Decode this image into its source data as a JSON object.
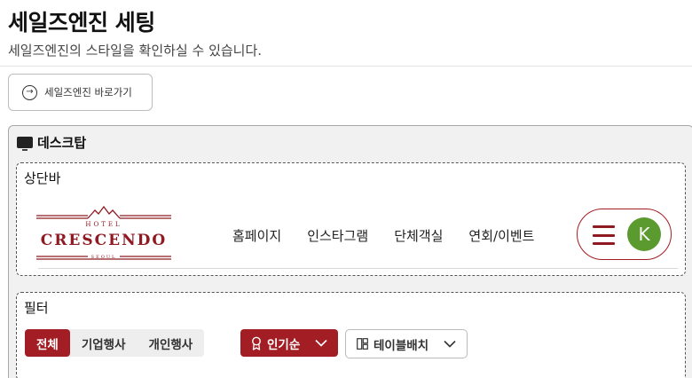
{
  "header": {
    "title": "세일즈엔진 세팅",
    "subtitle": "세일즈엔진의 스타일을 확인하실 수 있습니다."
  },
  "goto_button": {
    "label": "세일즈엔진 바로가기",
    "icon": "arrow-circle-right-icon"
  },
  "desktop_section": {
    "title": "데스크탑",
    "icon": "monitor-icon",
    "topbar_panel": {
      "title": "상단바",
      "logo": {
        "hotel": "HOTEL",
        "name": "CRESCENDO",
        "city": "SEOUL",
        "color": "#8f1a22"
      },
      "nav_links": [
        "홈페이지",
        "인스타그램",
        "단체객실",
        "연회/이벤트"
      ],
      "menu": {
        "avatar_initial": "K",
        "avatar_color": "#5a9a2f",
        "accent": "#a31d24"
      }
    },
    "filter_panel": {
      "title": "필터",
      "segments": [
        "전체",
        "기업행사",
        "개인행사"
      ],
      "active_segment": "전체",
      "sort": {
        "label": "인기순",
        "icon": "award-icon"
      },
      "layout": {
        "label": "테이블배치",
        "icon": "layout-grid-icon"
      }
    }
  }
}
